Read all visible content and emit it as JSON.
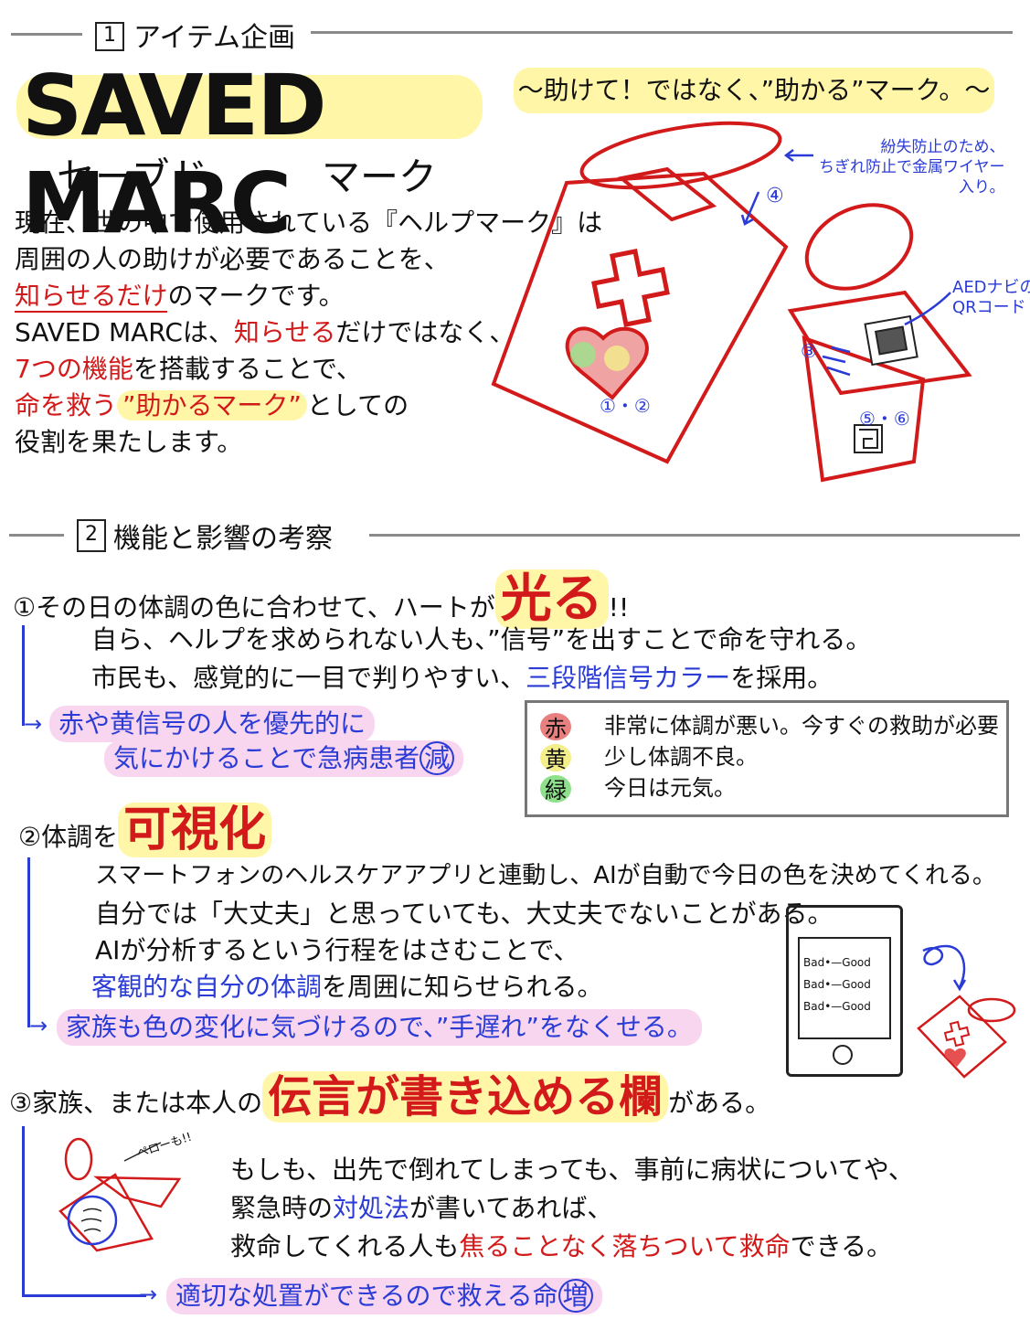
{
  "section1": {
    "num": "1",
    "title": "アイテム企画",
    "brand": "SAVED MARC",
    "brand_kana_1": "セーブド",
    "brand_kana_2": "マーク",
    "tagline": "〜助けて！ではなく、”助かる”マーク。〜",
    "intro": {
      "line1": "現在、世の中で使用されている『ヘルプマーク』は",
      "line2": "周囲の人の助けが必要であることを、",
      "line3_a": "知らせるだけ",
      "line3_b": "のマークです。",
      "line4_a": "SAVED MARCは、",
      "line4_b": "知らせる",
      "line4_c": "だけではなく、",
      "line5_a": "7つの機能",
      "line5_b": "を搭載することで、",
      "line6_a": "命を救う",
      "line6_b": "”助かるマーク”",
      "line6_c": "としての",
      "line7": "役割を果たします。"
    },
    "annotations": {
      "wire": "紛失防止のため、\nちぎれ防止で金属ワイヤー\n入り。",
      "aed": "AEDナビの\nQRコード",
      "n4": "④",
      "n12": "①・②",
      "n3": "③",
      "n56": "⑤・⑥"
    }
  },
  "section2": {
    "num": "2",
    "title": "機能と影響の考察",
    "item1": {
      "marker": "①",
      "lead": "その日の体調の色に合わせて、ハートが",
      "emph": "光る",
      "tail": "!!",
      "line2": "自ら、ヘルプを求められない人も、”信号”を出すことで命を守れる。",
      "line3_a": "市民も、感覚的に一目で判りやすい、",
      "line3_b": "三段階信号カラー",
      "line3_c": "を採用。",
      "effect1": "赤や黄信号の人を優先的に",
      "effect2": "気にかけることで急病患者",
      "effect2_mark": "減"
    },
    "legend": [
      {
        "label": "赤",
        "desc": "非常に体調が悪い。今すぐの救助が必要",
        "color": "#e98080"
      },
      {
        "label": "黄",
        "desc": "少し体調不良。",
        "color": "#f3ee8a"
      },
      {
        "label": "緑",
        "desc": "今日は元気。",
        "color": "#8ee08a"
      }
    ],
    "item2": {
      "marker": "②",
      "lead": "体調を",
      "emph": "可視化",
      "line1": "スマートフォンのヘルスケアアプリと連動し、AIが自動で今日の色を決めてくれる。",
      "line2": "自分では「大丈夫」と思っていても、大丈夫でないことがある。",
      "line3": "AIが分析するという行程をはさむことで、",
      "line4_a": "客観的な自分の体調",
      "line4_b": "を周囲に知らせられる。",
      "effect": "家族も色の変化に気づけるので、”手遅れ”をなくせる。",
      "phone_rows": [
        {
          "bad": "Bad",
          "good": "Good"
        },
        {
          "bad": "Bad",
          "good": "Good"
        },
        {
          "bad": "Bad",
          "good": "Good"
        }
      ]
    },
    "item3": {
      "marker": "③",
      "lead": "家族、または本人の",
      "emph": "伝言が書き込める欄",
      "tail": "がある。",
      "line1": "もしも、出先で倒れてしまっても、事前に病状についてや、",
      "line2_a": "緊急時の",
      "line2_b": "対処法",
      "line2_c": "が書いてあれば、",
      "line3_a": "救命してくれる人も",
      "line3_b": "焦ることなく落ちついて救命",
      "line3_c": "できる。",
      "effect": "適切な処置ができるので救える命",
      "effect_mark": "増",
      "doodle": "ペローも!!"
    }
  }
}
